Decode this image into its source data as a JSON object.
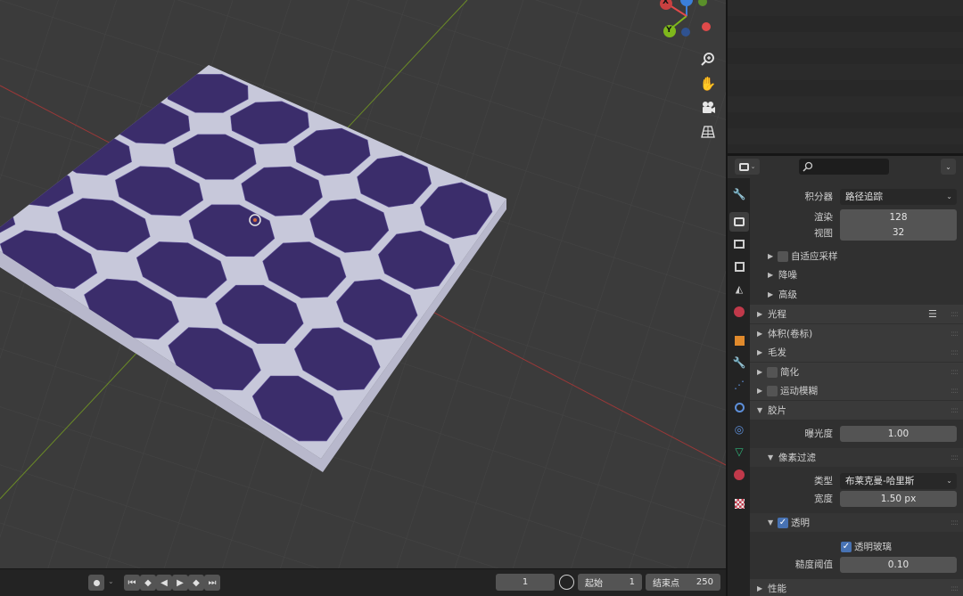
{
  "viewport": {
    "gizmo": {
      "x_label": "X",
      "y_label": "Y",
      "z_label": "Z"
    },
    "nav_icons": [
      "zoom-icon",
      "hand-pan-icon",
      "camera-icon",
      "grid-ortho-icon"
    ],
    "panel_color": "#3b2d6b"
  },
  "timeline": {
    "current_frame": "1",
    "start_label": "起始",
    "start_value": "1",
    "end_label": "结束点",
    "end_value": "250"
  },
  "properties": {
    "integrator": {
      "label": "积分器",
      "value": "路径追踪"
    },
    "samples": {
      "render_label": "渲染",
      "render_value": "128",
      "viewport_label": "视图",
      "viewport_value": "32"
    },
    "sub_panels": [
      "自适应采样",
      "降噪",
      "高级"
    ],
    "panels": {
      "light_paths": "光程",
      "volumes": "体积(卷标)",
      "hair": "毛发",
      "simplify": "简化",
      "motion_blur": "运动模糊",
      "film": "胶片",
      "performance": "性能"
    },
    "film": {
      "exposure_label": "曝光度",
      "exposure_value": "1.00",
      "pixel_filter": "像素过滤",
      "type_label": "类型",
      "type_value": "布莱克曼-哈里斯",
      "width_label": "宽度",
      "width_value": "1.50 px",
      "transparent": "透明",
      "transparent_glass": "透明玻璃",
      "roughness_label": "糙度阈值",
      "roughness_value": "0.10"
    }
  }
}
